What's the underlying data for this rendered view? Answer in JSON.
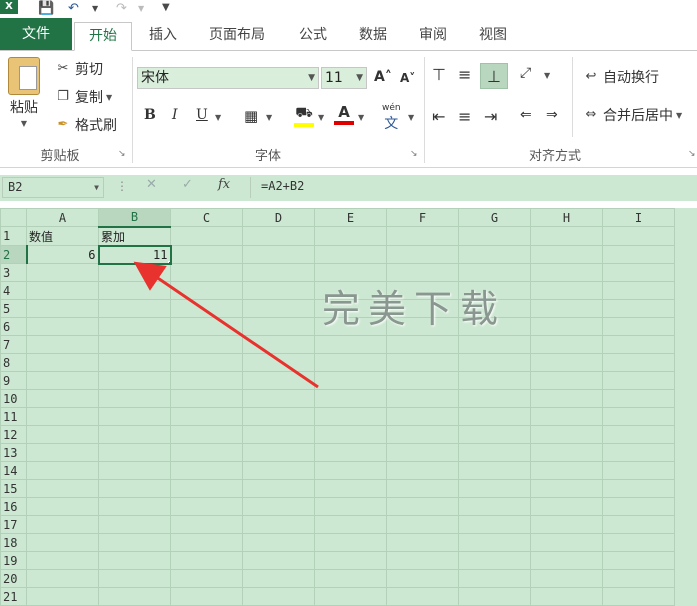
{
  "quick_access": {
    "app_badge": "X"
  },
  "tabs": [
    {
      "label": "文件"
    },
    {
      "label": "开始"
    },
    {
      "label": "插入"
    },
    {
      "label": "页面布局"
    },
    {
      "label": "公式"
    },
    {
      "label": "数据"
    },
    {
      "label": "审阅"
    },
    {
      "label": "视图"
    }
  ],
  "ribbon": {
    "clipboard": {
      "paste": "粘贴",
      "cut": "剪切",
      "copy": "复制",
      "format_painter": "格式刷",
      "group_label": "剪贴板"
    },
    "font": {
      "font_name": "宋体",
      "font_size": "11",
      "group_label": "字体",
      "bold": "B",
      "italic": "I",
      "underline": "U",
      "font_color_icon": "A",
      "phonetic": "wén"
    },
    "alignment": {
      "wrap_text": "自动换行",
      "merge_center": "合并后居中",
      "group_label": "对齐方式"
    }
  },
  "formula_bar": {
    "name_box": "B2",
    "fx": "fx",
    "formula": "=A2+B2"
  },
  "sheet": {
    "columns": [
      "A",
      "B",
      "C",
      "D",
      "E",
      "F",
      "G",
      "H",
      "I"
    ],
    "rows": [
      {
        "num": "1",
        "cells": [
          "数值",
          "累加",
          "",
          "",
          "",
          "",
          "",
          "",
          ""
        ]
      },
      {
        "num": "2",
        "cells": [
          "6",
          "11",
          "",
          "",
          "",
          "",
          "",
          "",
          ""
        ]
      },
      {
        "num": "3",
        "cells": [
          "",
          "",
          "",
          "",
          "",
          "",
          "",
          "",
          ""
        ]
      },
      {
        "num": "4",
        "cells": [
          "",
          "",
          "",
          "",
          "",
          "",
          "",
          "",
          ""
        ]
      },
      {
        "num": "5",
        "cells": [
          "",
          "",
          "",
          "",
          "",
          "",
          "",
          "",
          ""
        ]
      },
      {
        "num": "6",
        "cells": [
          "",
          "",
          "",
          "",
          "",
          "",
          "",
          "",
          ""
        ]
      },
      {
        "num": "7",
        "cells": [
          "",
          "",
          "",
          "",
          "",
          "",
          "",
          "",
          ""
        ]
      },
      {
        "num": "8",
        "cells": [
          "",
          "",
          "",
          "",
          "",
          "",
          "",
          "",
          ""
        ]
      },
      {
        "num": "9",
        "cells": [
          "",
          "",
          "",
          "",
          "",
          "",
          "",
          "",
          ""
        ]
      },
      {
        "num": "10",
        "cells": [
          "",
          "",
          "",
          "",
          "",
          "",
          "",
          "",
          ""
        ]
      },
      {
        "num": "11",
        "cells": [
          "",
          "",
          "",
          "",
          "",
          "",
          "",
          "",
          ""
        ]
      },
      {
        "num": "12",
        "cells": [
          "",
          "",
          "",
          "",
          "",
          "",
          "",
          "",
          ""
        ]
      },
      {
        "num": "13",
        "cells": [
          "",
          "",
          "",
          "",
          "",
          "",
          "",
          "",
          ""
        ]
      },
      {
        "num": "14",
        "cells": [
          "",
          "",
          "",
          "",
          "",
          "",
          "",
          "",
          ""
        ]
      },
      {
        "num": "15",
        "cells": [
          "",
          "",
          "",
          "",
          "",
          "",
          "",
          "",
          ""
        ]
      },
      {
        "num": "16",
        "cells": [
          "",
          "",
          "",
          "",
          "",
          "",
          "",
          "",
          ""
        ]
      },
      {
        "num": "17",
        "cells": [
          "",
          "",
          "",
          "",
          "",
          "",
          "",
          "",
          ""
        ]
      },
      {
        "num": "18",
        "cells": [
          "",
          "",
          "",
          "",
          "",
          "",
          "",
          "",
          ""
        ]
      },
      {
        "num": "19",
        "cells": [
          "",
          "",
          "",
          "",
          "",
          "",
          "",
          "",
          ""
        ]
      },
      {
        "num": "20",
        "cells": [
          "",
          "",
          "",
          "",
          "",
          "",
          "",
          "",
          ""
        ]
      },
      {
        "num": "21",
        "cells": [
          "",
          "",
          "",
          "",
          "",
          "",
          "",
          "",
          ""
        ]
      }
    ]
  },
  "watermark": "完美下载",
  "colors": {
    "accent": "#217346",
    "grid_bg": "#cde8d2",
    "arrow": "#e8322e"
  }
}
